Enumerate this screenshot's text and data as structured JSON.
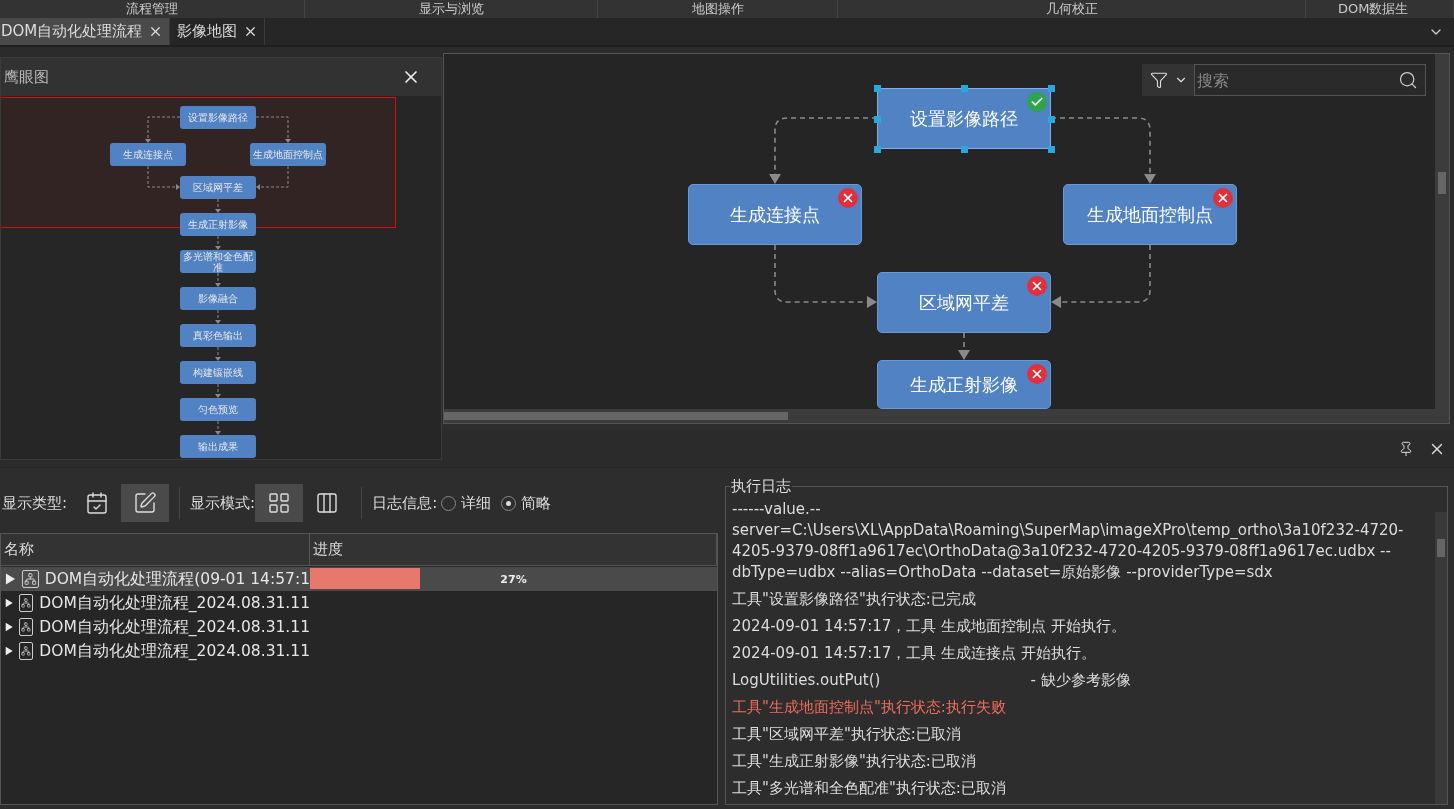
{
  "ribbon_groups": [
    "流程管理",
    "显示与浏览",
    "地图操作",
    "几何校正",
    "DOM数据生"
  ],
  "tabs": [
    {
      "label": "DOM自动化处理流程",
      "selected": true
    },
    {
      "label": "影像地图",
      "selected": false
    }
  ],
  "overview": {
    "title": "鹰眼图",
    "nodes": [
      "设置影像路径",
      "生成连接点",
      "生成地面控制点",
      "区域网平差",
      "生成正射影像",
      "多光谱和全色配准",
      "影像融合",
      "真彩色输出",
      "构建镶嵌线",
      "匀色预览",
      "输出成果"
    ]
  },
  "canvas": {
    "search": {
      "placeholder": "搜索"
    },
    "nodes": [
      {
        "label": "设置影像路径",
        "succeeded": true,
        "selected": true
      },
      {
        "label": "生成连接点",
        "succeeded": false,
        "selected": false
      },
      {
        "label": "生成地面控制点",
        "succeeded": false,
        "selected": false
      },
      {
        "label": "区域网平差",
        "succeeded": false,
        "selected": false
      },
      {
        "label": "生成正射影像",
        "succeeded": false,
        "selected": false
      }
    ]
  },
  "toolbar": {
    "display_type": {
      "label": "显示类型:",
      "options": [
        {
          "kind": "checklist",
          "selected": false
        },
        {
          "kind": "edit",
          "selected": true
        }
      ]
    },
    "display_mode": {
      "label": "显示模式:",
      "options": [
        {
          "kind": "grid",
          "selected": true
        },
        {
          "kind": "columns",
          "selected": false
        }
      ]
    },
    "log_info": {
      "label": "日志信息:",
      "options": [
        {
          "label": "详细",
          "selected": false
        },
        {
          "label": "简略",
          "selected": true
        }
      ]
    }
  },
  "task_table": {
    "columns": [
      "名称",
      "进度"
    ],
    "rows": [
      {
        "name": "DOM自动化处理流程(09-01 14:57:1",
        "selected": true,
        "progress": {
          "level": 0.27,
          "reading": "27%"
        }
      },
      {
        "name": "DOM自动化处理流程_2024.08.31.11",
        "selected": false
      },
      {
        "name": "DOM自动化处理流程_2024.08.31.11",
        "selected": false
      },
      {
        "name": "DOM自动化处理流程_2024.08.31.11",
        "selected": false
      }
    ]
  },
  "log": {
    "title": "执行日志",
    "entries": [
      {
        "kind": "info",
        "text": "------value.--server=C:\\Users\\XL\\AppData\\Roaming\\SuperMap\\imageXPro\\temp_ortho\\3a10f232-4720-4205-9379-08ff1a9617ec\\OrthoData@3a10f232-4720-4205-9379-08ff1a9617ec.udbx --dbType=udbx --alias=OrthoData --dataset=原始影像 --providerType=sdx"
      },
      {
        "kind": "info",
        "text": "工具\"设置影像路径\"执行状态:已完成"
      },
      {
        "kind": "info",
        "text": "2024-09-01 14:57:17，工具 生成地面控制点 开始执行。"
      },
      {
        "kind": "info",
        "text": "2024-09-01 14:57:17，工具 生成连接点 开始执行。"
      },
      {
        "kind": "info",
        "text": "LogUtilities.outPut()",
        "detail": "- 缺少参考影像"
      },
      {
        "kind": "error",
        "text": "工具\"生成地面控制点\"执行状态:执行失败"
      },
      {
        "kind": "info",
        "text": "工具\"区域网平差\"执行状态:已取消"
      },
      {
        "kind": "info",
        "text": "工具\"生成正射影像\"执行状态:已取消"
      },
      {
        "kind": "info",
        "text": "工具\"多光谱和全色配准\"执行状态:已取消"
      }
    ]
  }
}
